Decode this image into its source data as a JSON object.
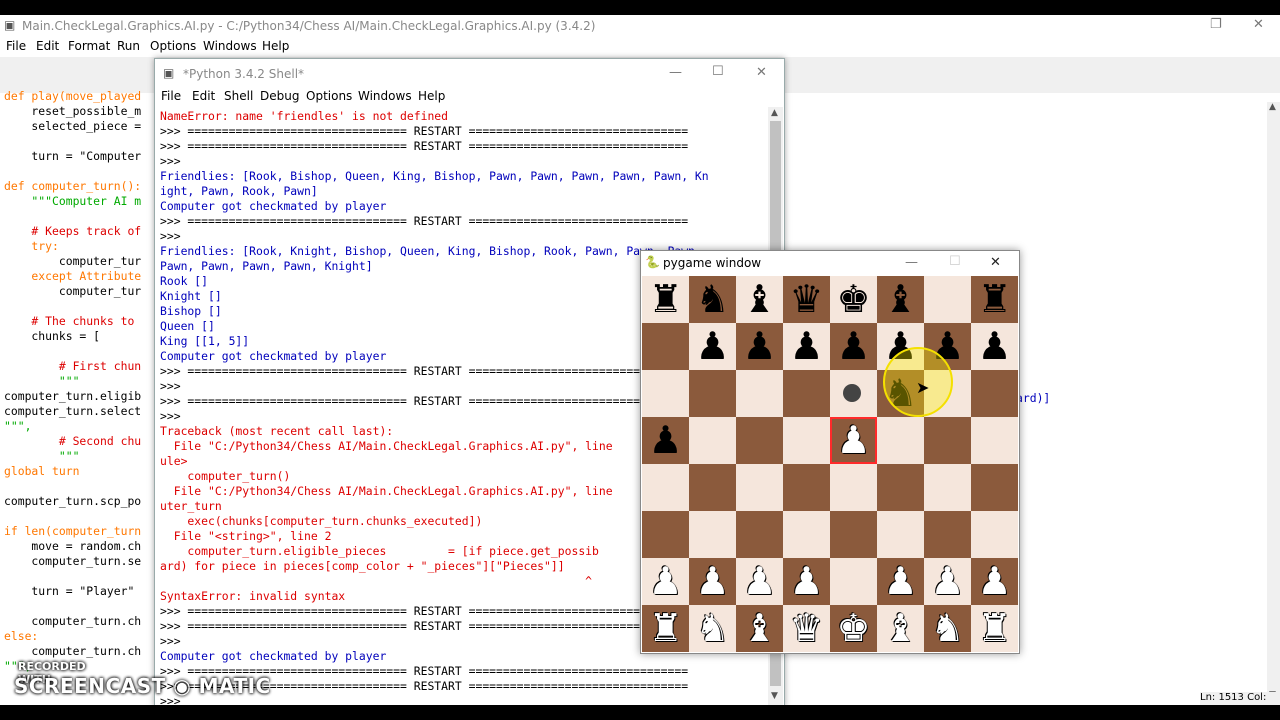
{
  "editor": {
    "title": "Main.CheckLegal.Graphics.AI.py - C:/Python34/Chess AI/Main.CheckLegal.Graphics.AI.py (3.4.2)",
    "menu": [
      "File",
      "Edit",
      "Format",
      "Run",
      "Options",
      "Windows",
      "Help"
    ],
    "status": "Ln: 1513 Col:",
    "peek_text": "ard)]",
    "code_lines": [
      "def play(move_played",
      "    reset_possible_m",
      "    selected_piece =",
      "",
      "    turn = \"Computer",
      "",
      "def computer_turn():",
      "    \"\"\"Computer AI m",
      "",
      "    # Keeps track of",
      "    try:",
      "        computer_tur",
      "    except Attribute",
      "        computer_tur",
      "",
      "    # The chunks to",
      "    chunks = [",
      "",
      "        # First chun",
      "        \"\"\"",
      "computer_turn.eligib",
      "computer_turn.select",
      "\"\"\",",
      "        # Second chu",
      "        \"\"\"",
      "global turn",
      "",
      "computer_turn.scp_po",
      "",
      "if len(computer_turn",
      "    move = random.ch",
      "    computer_turn.se",
      "",
      "    turn = \"Player\"",
      "",
      "    computer_turn.ch",
      "else:",
      "    computer_turn.ch",
      "\"\"\","
    ]
  },
  "shell": {
    "title": "*Python 3.4.2 Shell*",
    "menu": [
      "File",
      "Edit",
      "Shell",
      "Debug",
      "Options",
      "Windows",
      "Help"
    ],
    "lines": [
      {
        "c": "err",
        "t": "NameError: name 'friendles' is not defined"
      },
      {
        "c": "pr",
        "t": ">>> ================================ RESTART ================================"
      },
      {
        "c": "pr",
        "t": ">>> ================================ RESTART ================================"
      },
      {
        "c": "pr",
        "t": ">>>"
      },
      {
        "c": "out",
        "t": "Friendlies: [Rook, Bishop, Queen, King, Bishop, Pawn, Pawn, Pawn, Pawn, Pawn, Kn"
      },
      {
        "c": "out",
        "t": "ight, Pawn, Rook, Pawn]"
      },
      {
        "c": "out",
        "t": "Computer got checkmated by player"
      },
      {
        "c": "pr",
        "t": ">>> ================================ RESTART ================================"
      },
      {
        "c": "pr",
        "t": ">>>"
      },
      {
        "c": "out",
        "t": "Friendlies: [Rook, Knight, Bishop, Queen, King, Bishop, Rook, Pawn, Pawn, Pawn,"
      },
      {
        "c": "out",
        "t": "Pawn, Pawn, Pawn, Pawn, Knight]"
      },
      {
        "c": "out",
        "t": "Rook []"
      },
      {
        "c": "out",
        "t": "Knight []"
      },
      {
        "c": "out",
        "t": "Bishop []"
      },
      {
        "c": "out",
        "t": "Queen []"
      },
      {
        "c": "out",
        "t": "King [[1, 5]]"
      },
      {
        "c": "out",
        "t": "Computer got checkmated by player"
      },
      {
        "c": "pr",
        "t": ">>> ================================ RESTART ================================"
      },
      {
        "c": "pr",
        "t": ">>>"
      },
      {
        "c": "pr",
        "t": ">>> ================================ RESTART ================================"
      },
      {
        "c": "pr",
        "t": ">>>"
      },
      {
        "c": "err",
        "t": "Traceback (most recent call last):"
      },
      {
        "c": "err",
        "t": "  File \"C:/Python34/Chess AI/Main.CheckLegal.Graphics.AI.py\", line"
      },
      {
        "c": "err",
        "t": "ule>"
      },
      {
        "c": "err",
        "t": "    computer_turn()"
      },
      {
        "c": "err",
        "t": "  File \"C:/Python34/Chess AI/Main.CheckLegal.Graphics.AI.py\", line"
      },
      {
        "c": "err",
        "t": "uter_turn"
      },
      {
        "c": "err",
        "t": "    exec(chunks[computer_turn.chunks_executed])"
      },
      {
        "c": "err",
        "t": "  File \"<string>\", line 2"
      },
      {
        "c": "err",
        "t": "    computer_turn.eligible_pieces         = [if piece.get_possib"
      },
      {
        "c": "err",
        "t": "ard) for piece in pieces[comp_color + \"_pieces\"][\"Pieces\"]]"
      },
      {
        "c": "err",
        "t": "                                                              ^"
      },
      {
        "c": "err",
        "t": "SyntaxError: invalid syntax"
      },
      {
        "c": "pr",
        "t": ">>> ================================ RESTART ================================"
      },
      {
        "c": "pr",
        "t": ">>> ================================ RESTART ================================"
      },
      {
        "c": "pr",
        "t": ">>>"
      },
      {
        "c": "out",
        "t": "Computer got checkmated by player"
      },
      {
        "c": "pr",
        "t": ">>> ================================ RESTART ================================"
      },
      {
        "c": "pr",
        "t": ">>> ================================ RESTART ================================"
      },
      {
        "c": "pr",
        "t": ">>>"
      }
    ]
  },
  "pygame": {
    "title": "pygame window",
    "board": [
      [
        "br",
        "bn",
        "bb",
        "bq",
        "bk",
        "bb",
        "",
        "br"
      ],
      [
        "",
        "bp",
        "bp",
        "bp",
        "bp",
        "bp",
        "bp",
        "bp"
      ],
      [
        "",
        "",
        "",
        "",
        "",
        "bn",
        "",
        ""
      ],
      [
        "bp",
        "",
        "",
        "",
        "wp",
        "",
        "",
        ""
      ],
      [
        "",
        "",
        "",
        "",
        "",
        "",
        "",
        ""
      ],
      [
        "",
        "",
        "",
        "",
        "",
        "",
        "",
        ""
      ],
      [
        "wp",
        "wp",
        "wp",
        "wp",
        "",
        "wp",
        "wp",
        "wp"
      ],
      [
        "wr",
        "wn",
        "wb",
        "wq",
        "wk",
        "wb",
        "wn",
        "wr"
      ]
    ],
    "selected_square": [
      3,
      4
    ],
    "glyphs": {
      "k": "♚",
      "q": "♛",
      "r": "♜",
      "b": "♝",
      "n": "♞",
      "p": "♟"
    },
    "colors": {
      "light": "#f5e6dc",
      "dark": "#8b5a3c",
      "highlight": "#ff2a2a"
    }
  },
  "watermark": {
    "line1": "RECORDED WITH",
    "line2": "SCREENCAST ◉ MATIC"
  }
}
